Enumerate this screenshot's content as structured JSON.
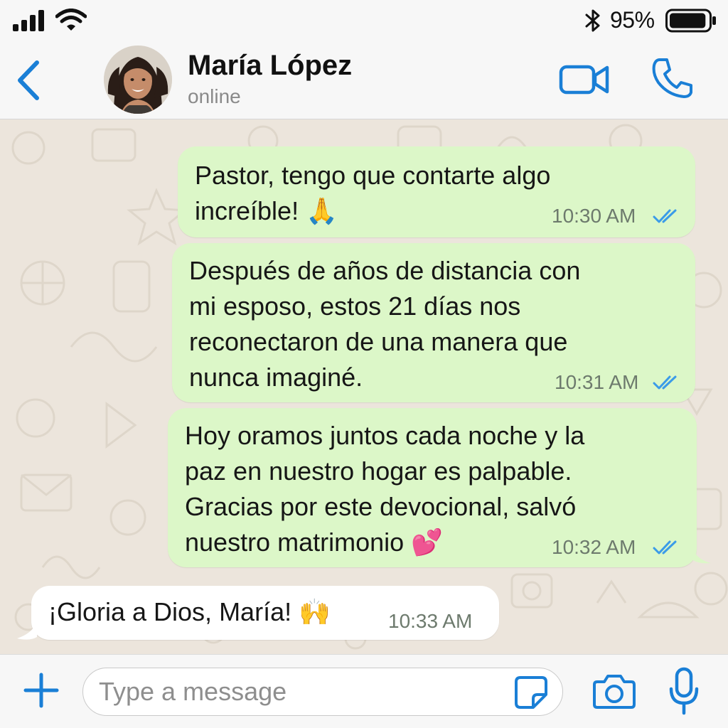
{
  "status_bar": {
    "battery_percent": "95%",
    "battery_level": 0.95,
    "icons": [
      "signal-icon",
      "wifi-icon",
      "bluetooth-icon",
      "battery-icon"
    ]
  },
  "header": {
    "contact_name": "María López",
    "contact_status": "online",
    "icons": [
      "back-chevron-icon",
      "video-call-icon",
      "phone-call-icon"
    ]
  },
  "messages": [
    {
      "direction": "outgoing",
      "text": "Pastor, tengo que contarte algo\nincreíble! 🙏",
      "time": "10:30 AM",
      "read": true
    },
    {
      "direction": "outgoing",
      "text": "Después de años de distancia con\nmi esposo, estos 21 días nos\nreconectaron de una manera que\nnunca imaginé.",
      "time": "10:31 AM",
      "read": true
    },
    {
      "direction": "outgoing",
      "text": "Hoy oramos juntos cada noche y la\npaz en nuestro hogar es palpable.\nGracias por este devocional, salvó\nnuestro matrimonio 💕",
      "time": "10:32 AM",
      "read": true
    },
    {
      "direction": "incoming",
      "text": "¡Gloria a Dios, María! 🙌",
      "time": "10:33 AM"
    }
  ],
  "composer": {
    "placeholder": "Type a message",
    "value": "",
    "icons": [
      "plus-icon",
      "sticker-icon",
      "camera-icon",
      "microphone-icon"
    ]
  },
  "colors": {
    "accent": "#1a7fd6",
    "outgoing_bubble": "#dcf7c8",
    "incoming_bubble": "#ffffff",
    "read_ticks": "#3b9be8",
    "wallpaper": "#ece5dc"
  }
}
